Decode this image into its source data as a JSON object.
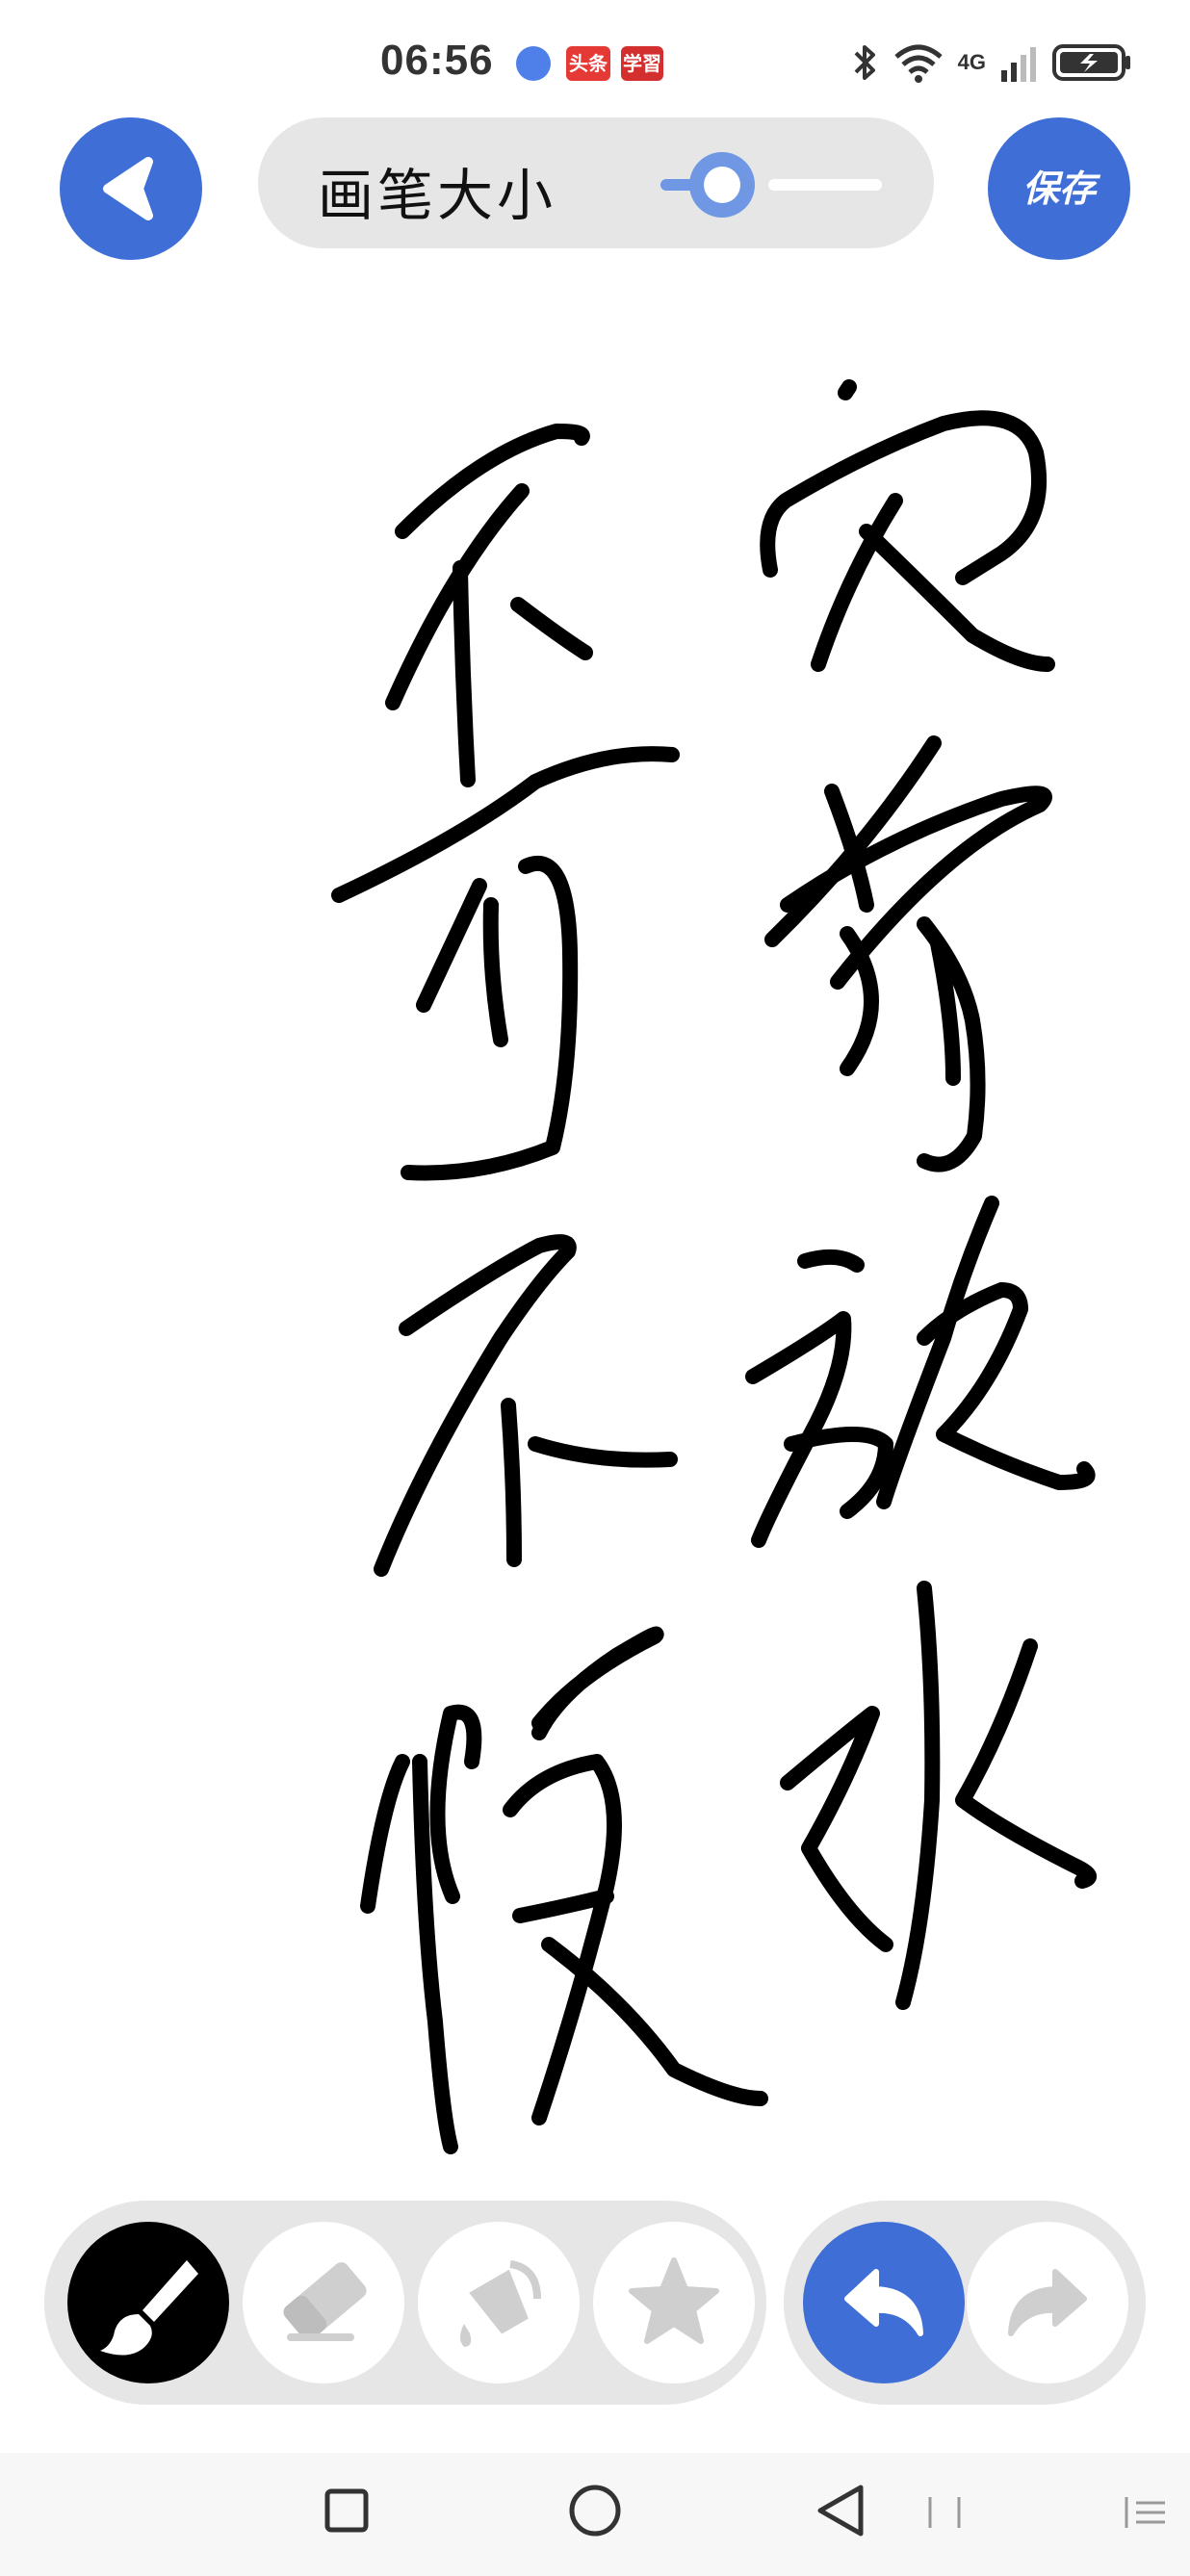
{
  "status_bar": {
    "time": "06:56",
    "badges": [
      "头条",
      "学習"
    ],
    "network": "4G"
  },
  "toolbar": {
    "back_icon": "back-arrow-icon",
    "brush_size_label": "画笔大小",
    "brush_size_level": 0.3,
    "save_label": "保存"
  },
  "canvas": {
    "handwritten_lines": [
      "不可不慎",
      "灾前放水"
    ]
  },
  "bottom_tools": {
    "tools": [
      {
        "name": "brush-icon",
        "active": true
      },
      {
        "name": "eraser-icon",
        "active": false
      },
      {
        "name": "paint-bucket-icon",
        "active": false
      },
      {
        "name": "star-icon",
        "active": false
      }
    ],
    "history": [
      {
        "name": "undo-icon",
        "active": true
      },
      {
        "name": "redo-icon",
        "active": false
      }
    ]
  },
  "nav_bar": {
    "buttons": [
      "recent-apps-icon",
      "home-icon",
      "back-icon",
      "accessibility-icon"
    ]
  },
  "colors": {
    "accent": "#3f6fd6",
    "toolbar_bg": "#e6e6e6",
    "slider": "#6f97e3",
    "ink": "#000000"
  }
}
